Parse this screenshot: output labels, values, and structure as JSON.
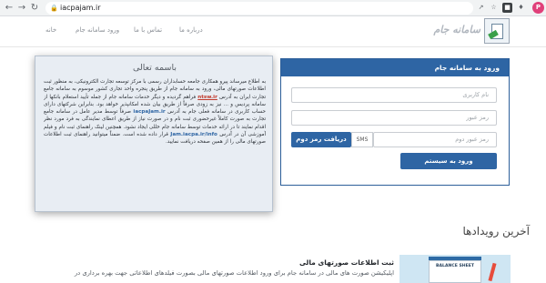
{
  "browser": {
    "url": "iacpajam.ir",
    "profile_initial": "P",
    "icons": [
      "back-icon",
      "forward-icon",
      "reload-icon",
      "lock-icon",
      "share-icon",
      "star-icon",
      "extension-icon",
      "extension-icon-2"
    ]
  },
  "header": {
    "logo_text": "سامانه جام",
    "menu": [
      "درباره ما",
      "تماس با ما",
      "ورود سامانه جام",
      "خانه"
    ]
  },
  "login": {
    "title": "ورود به سامانه جام",
    "username_placeholder": "نام کاربری",
    "password_placeholder": "رمز عبور",
    "otp_placeholder": "رمز عبور دوم",
    "sms_option": "SMS",
    "otp_button": "دریافت رمز دوم",
    "submit_button": "ورود به سیستم"
  },
  "notice": {
    "title": "باسمه تعالی",
    "p1": "به اطلاع میرساند پیرو همکاری جامعه حسابداران رسمی با مرکز توسعه تجارت الکترونیکی، به منظور ثبت اطلاعات صورتهای مالی، ورود به سامانه جام از طریق پنجره واحد تجاری کشور موسوم به سامانه جامع تجارت ایران به آدرس",
    "link1": "ntsw.ir",
    "p2": "فراهم گردیده و دیگر خدمات سامانه جام از جمله تأیید استعلام بانکها از سامانه پردیس و ... نیز به زودی صرفاً از طریق بیان شده امکانپذیر خواهد بود. بنابراین شرکتهای دارای حساب کاربری در سامانه فعلی جام به آدرس",
    "link2": "iacpaJam.ir",
    "p3": "صرفاً توسط مدیر عامل در سامانه جامع تجارت به صورت کاملاً غیرحضوری ثبت نام و در صورت نیاز از طریق اعطای نمایندگی به فرد مورد نظر اقدام نمایند تا در ارائه خدمات توسط سامانه جام خللی ایجاد نشود. همچنین لینک راهنمای ثبت نام و فیلم آموزشی آن در آدرس",
    "link3": "Jam.iacpa.ir/info",
    "p4": "قرار داده شده است. ضمناً میتوانید راهنمای ثبت اطلاعات صورتهای مالی را از همین صفحه دریافت نمایید."
  },
  "events": {
    "title": "آخرین رویدادها",
    "card_title": "ثبت اطلاعات صورتهای مالی",
    "card_desc": "اپلیکیشن صورت های مالی در سامانه جام برای ورود اطلاعات صورتهای مالی بصورت فیلدهای اطلاعاتی جهت بهره برداری در",
    "image_label": "BALANCE SHEET"
  }
}
